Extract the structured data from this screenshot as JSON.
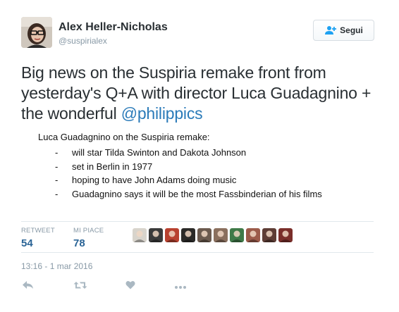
{
  "user": {
    "name": "Alex Heller-Nicholas",
    "handle": "@suspirialex"
  },
  "follow_button": {
    "label": "Segui",
    "icon": "add-user-icon"
  },
  "tweet": {
    "text_before_mention": "Big news on the Suspiria remake front from yesterday's Q+A with director Luca Guadagnino + the wonderful ",
    "mention": "@philippics"
  },
  "media": {
    "title": "Luca Guadagnino on the Suspiria remake:",
    "dash": "-",
    "items": [
      "will star Tilda Swinton and Dakota Johnson",
      "set in Berlin in 1977",
      "hoping to have John Adams doing music",
      "Guadagnino says it will be the most Fassbinderian of his films"
    ]
  },
  "stats": {
    "retweet_label": "RETWEET",
    "retweet_count": "54",
    "likes_label": "MI PIACE",
    "likes_count": "78"
  },
  "likers": [
    {
      "name": "liker-1",
      "color": "#d8d4cc"
    },
    {
      "name": "liker-2",
      "color": "#3a3a3a"
    },
    {
      "name": "liker-3",
      "color": "#b8412f"
    },
    {
      "name": "liker-4",
      "color": "#2b2a28"
    },
    {
      "name": "liker-5",
      "color": "#6b5a4e"
    },
    {
      "name": "liker-6",
      "color": "#8a6f5d"
    },
    {
      "name": "liker-7",
      "color": "#3f7a48"
    },
    {
      "name": "liker-8",
      "color": "#9c5b4a"
    },
    {
      "name": "liker-9",
      "color": "#5e3d35"
    },
    {
      "name": "liker-10",
      "color": "#7a2e2a"
    }
  ],
  "timestamp": "13:16 - 1 mar 2016",
  "actions": [
    "reply-icon",
    "retweet-icon",
    "like-icon",
    "more-icon"
  ],
  "colors": {
    "link": "#2b7bb9",
    "muted": "#8899a6",
    "count": "#2a6496",
    "divider": "#e1e8ed"
  }
}
